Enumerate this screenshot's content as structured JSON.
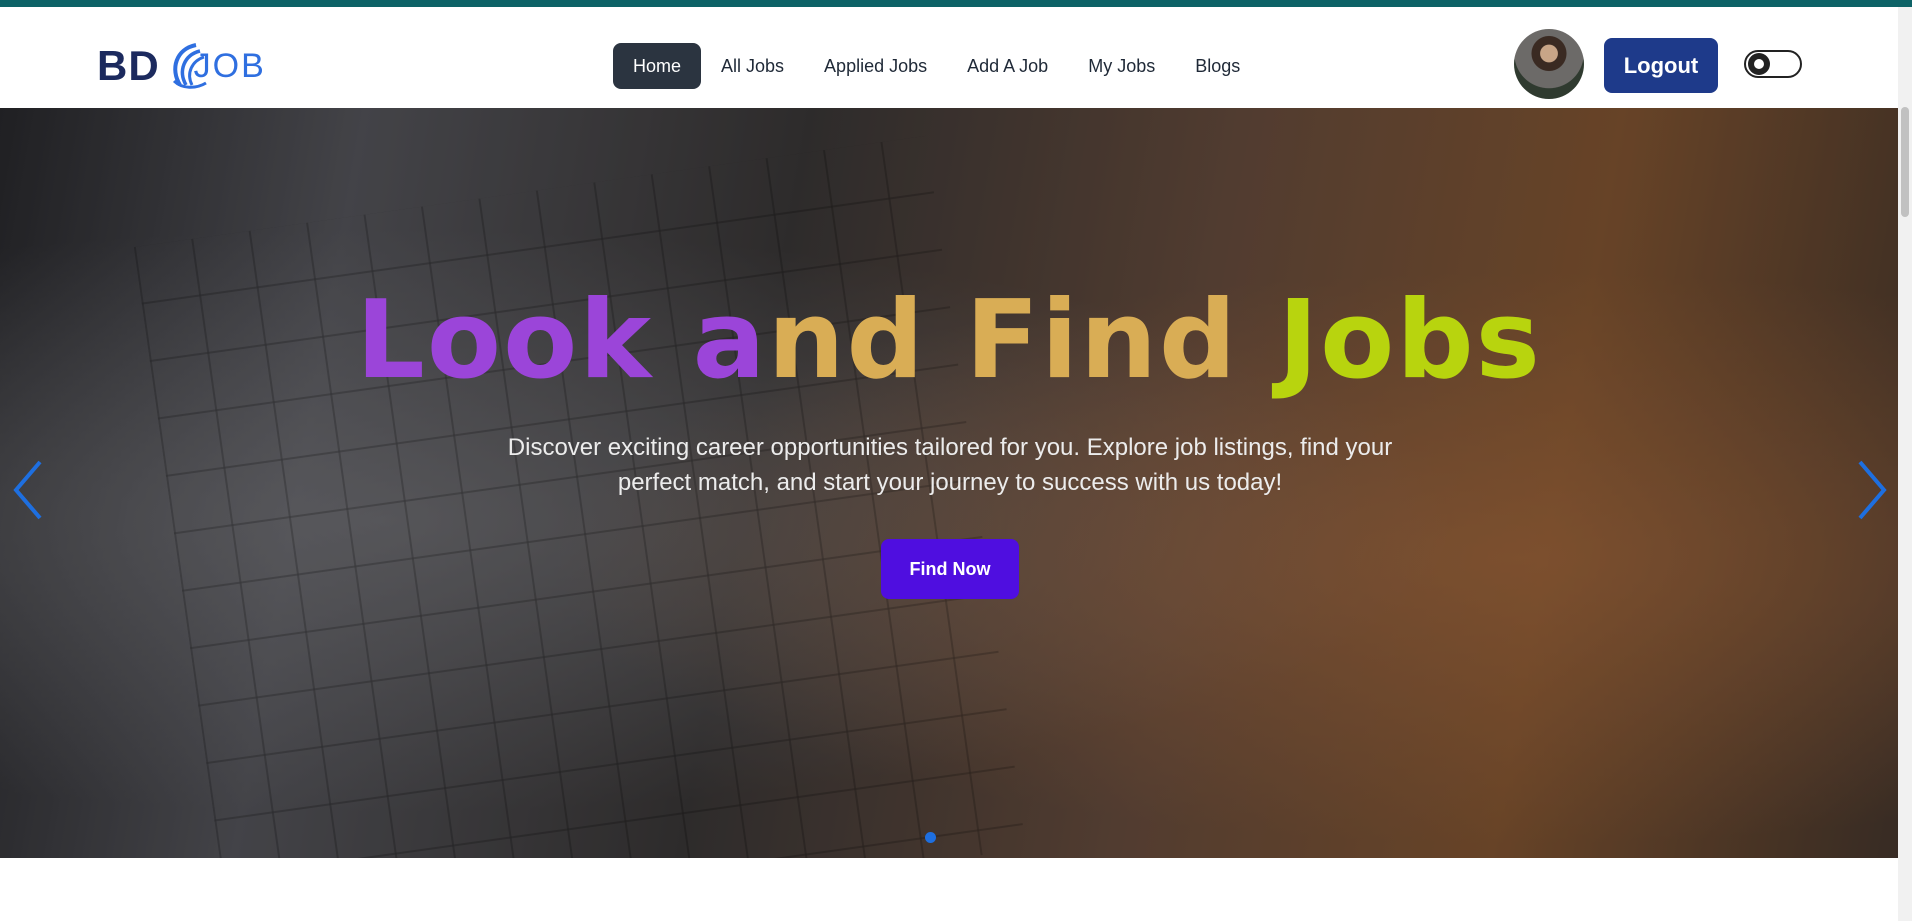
{
  "logo": {
    "text_bd": "BD",
    "text_job": "JOB",
    "color_dark": "#1c2a5e",
    "color_accent": "#2f6fe0"
  },
  "nav": {
    "items": [
      {
        "label": "Home",
        "active": true
      },
      {
        "label": "All Jobs"
      },
      {
        "label": "Applied Jobs"
      },
      {
        "label": "Add A Job"
      },
      {
        "label": "My Jobs"
      },
      {
        "label": "Blogs"
      }
    ],
    "logout_label": "Logout",
    "theme_toggle": "off"
  },
  "hero": {
    "title_part1": "Look a",
    "title_part2": "nd Find ",
    "title_part3": "Jobs",
    "subtitle": "Discover exciting career opportunities tailored for you. Explore job listings, find your perfect match, and start your journey to success with us today!",
    "cta_label": "Find Now",
    "slide_count": 1,
    "active_slide": 1
  },
  "colors": {
    "topbar": "#0d6266",
    "home_active_bg": "#2b3440",
    "logout_bg": "#1e3a8a",
    "cta_bg": "#4f0ee0",
    "title_purple": "#9b45d9",
    "title_gold": "#d9ad55",
    "title_lime": "#b8d40e",
    "carousel_arrow": "#1e6fe0"
  }
}
